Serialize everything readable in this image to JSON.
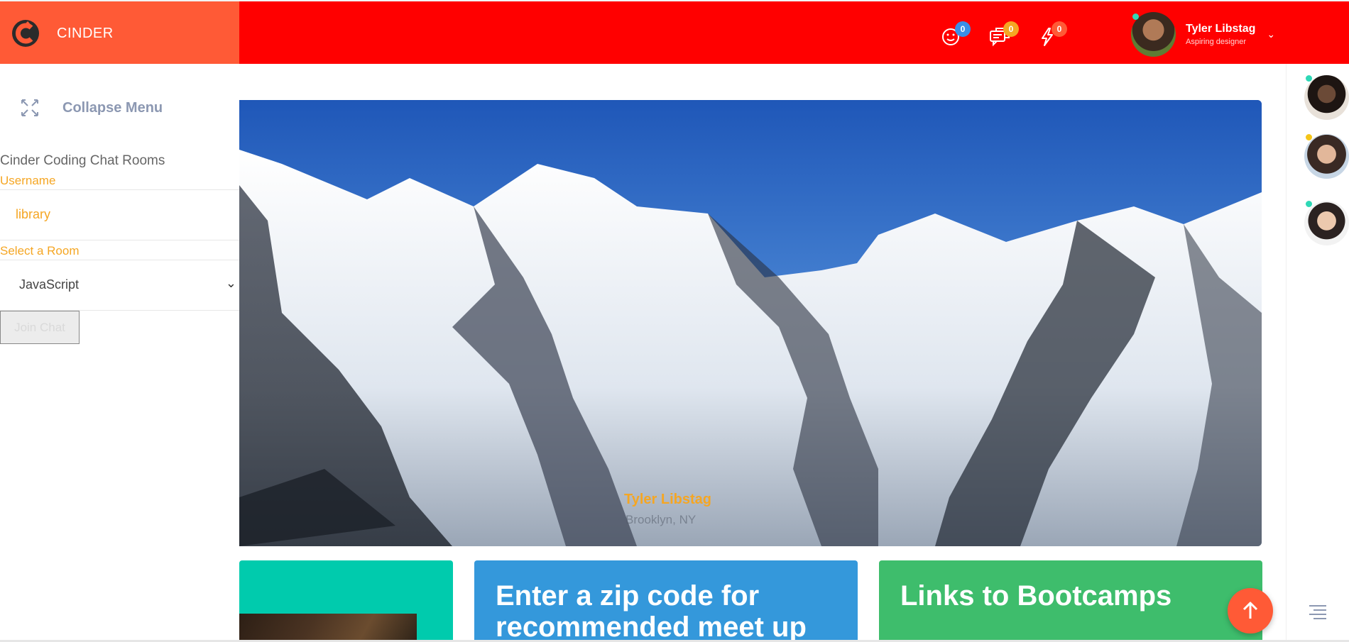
{
  "app": {
    "name": "CINDER"
  },
  "header": {
    "notifications": [
      {
        "icon": "smile-icon",
        "count": "0",
        "badge_color": "#3a8ee6"
      },
      {
        "icon": "chat-bubbles-icon",
        "count": "0",
        "badge_color": "#f5a623"
      },
      {
        "icon": "flash-icon",
        "count": "0",
        "badge_color": "#ff5a36"
      }
    ],
    "user": {
      "name": "Tyler Libstag",
      "role": "Aspiring designer"
    }
  },
  "sidebar": {
    "collapse_label": "Collapse Menu",
    "chat_title": "Cinder Coding Chat Rooms",
    "username_label": "Username",
    "username_value": "library",
    "room_label": "Select a Room",
    "room_value": "JavaScript",
    "join_label": "Join Chat"
  },
  "hero": {
    "name": "Tyler Libstag",
    "location": "Brooklyn, NY"
  },
  "cards": [
    {
      "title": "",
      "color": "#00cbad"
    },
    {
      "title": "Enter a zip code for recommended meet up",
      "color": "#3498db"
    },
    {
      "title": "Links to Bootcamps",
      "color": "#3ebd6c"
    }
  ],
  "colors": {
    "topbar": "#ff0000",
    "brand": "#ff5a36",
    "accent": "#f5a623"
  }
}
